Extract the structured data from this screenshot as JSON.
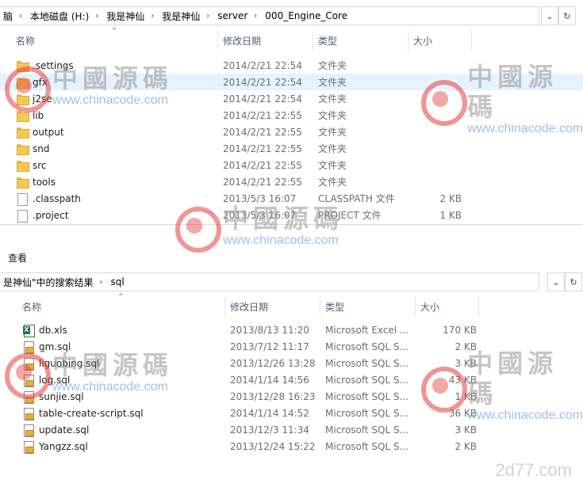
{
  "top": {
    "crumbs": [
      "脑",
      "本地磁盘 (H:)",
      "我是神仙",
      "我是神仙",
      "server",
      "000_Engine_Core"
    ],
    "columns": {
      "name": "名称",
      "date": "修改日期",
      "type": "类型",
      "size": "大小"
    },
    "rows": [
      {
        "icon": "folder-icon",
        "name": ".settings",
        "date": "2014/2/21 22:54",
        "type": "文件夹",
        "size": ""
      },
      {
        "icon": "folder-icon",
        "name": "gfx",
        "date": "2014/2/21 22:54",
        "type": "文件夹",
        "size": ""
      },
      {
        "icon": "folder-icon",
        "name": "j2se",
        "date": "2014/2/21 22:54",
        "type": "文件夹",
        "size": ""
      },
      {
        "icon": "folder-icon",
        "name": "lib",
        "date": "2014/2/21 22:55",
        "type": "文件夹",
        "size": ""
      },
      {
        "icon": "folder-icon",
        "name": "output",
        "date": "2014/2/21 22:55",
        "type": "文件夹",
        "size": ""
      },
      {
        "icon": "folder-icon",
        "name": "snd",
        "date": "2014/2/21 22:55",
        "type": "文件夹",
        "size": ""
      },
      {
        "icon": "folder-icon",
        "name": "src",
        "date": "2014/2/21 22:55",
        "type": "文件夹",
        "size": ""
      },
      {
        "icon": "folder-icon",
        "name": "tools",
        "date": "2014/2/21 22:55",
        "type": "文件夹",
        "size": ""
      },
      {
        "icon": "file-icon",
        "name": ".classpath",
        "date": "2013/5/3 16:07",
        "type": "CLASSPATH 文件",
        "size": "2 KB"
      },
      {
        "icon": "file-icon",
        "name": ".project",
        "date": "2013/5/3 16:07",
        "type": "PROJECT 文件",
        "size": "1 KB"
      }
    ]
  },
  "view_tab": "查看",
  "bottom": {
    "crumbs": [
      "是神仙\"中的搜索结果",
      "sql"
    ],
    "columns": {
      "name": "名称",
      "date": "修改日期",
      "type": "类型",
      "size": "大小"
    },
    "rows": [
      {
        "icon": "excel-icon",
        "name": "db.xls",
        "date": "2013/8/13 11:20",
        "type": "Microsoft Excel ...",
        "size": "170 KB"
      },
      {
        "icon": "sql-icon",
        "name": "gm.sql",
        "date": "2013/7/12 11:17",
        "type": "Microsoft SQL S...",
        "size": "2 KB"
      },
      {
        "icon": "sql-icon",
        "name": "liguobing.sql",
        "date": "2013/12/26 13:28",
        "type": "Microsoft SQL S...",
        "size": "3 KB"
      },
      {
        "icon": "sql-icon",
        "name": "log.sql",
        "date": "2014/1/14 14:56",
        "type": "Microsoft SQL S...",
        "size": "43 KB"
      },
      {
        "icon": "sql-icon",
        "name": "sunjie.sql",
        "date": "2013/12/28 16:23",
        "type": "Microsoft SQL S...",
        "size": "1 KB"
      },
      {
        "icon": "sql-icon",
        "name": "table-create-script.sql",
        "date": "2014/1/14 14:52",
        "type": "Microsoft SQL S...",
        "size": "36 KB"
      },
      {
        "icon": "sql-icon",
        "name": "update.sql",
        "date": "2013/12/3 11:34",
        "type": "Microsoft SQL S...",
        "size": "3 KB"
      },
      {
        "icon": "sql-icon",
        "name": "Yangzz.sql",
        "date": "2013/12/24 15:22",
        "type": "Microsoft SQL S...",
        "size": "2 KB"
      }
    ]
  },
  "watermark": {
    "cn": "中國源碼",
    "url": "www.chinacode.com",
    "corner": "2d77.com"
  }
}
